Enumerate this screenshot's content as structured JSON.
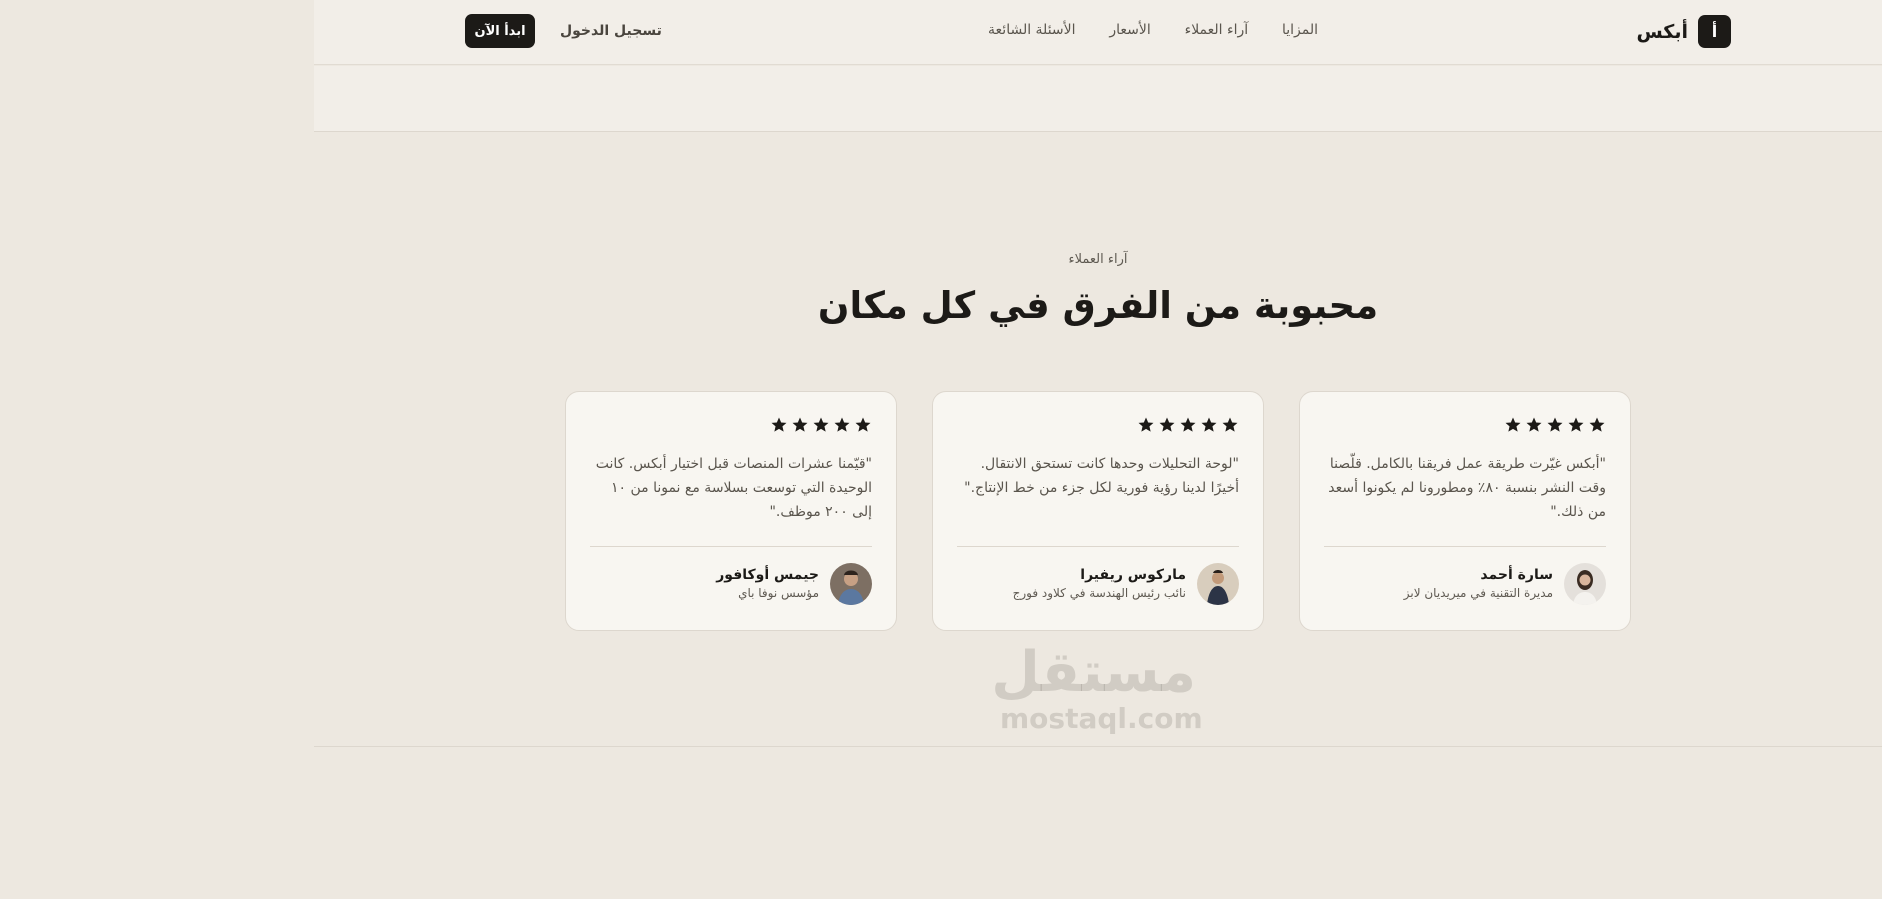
{
  "header": {
    "logo_letter": "أ",
    "brand_name": "أبكس",
    "nav": [
      "المزايا",
      "آراء العملاء",
      "الأسعار",
      "الأسئلة الشائعة"
    ],
    "login_label": "تسجيل الدخول",
    "cta_label": "ابدأ الآن"
  },
  "section": {
    "eyebrow": "آراء العملاء",
    "title": "محبوبة من الفرق في كل مكان"
  },
  "testimonials": [
    {
      "rating": 5,
      "quote": "\"أبكس غيّرت طريقة عمل فريقنا بالكامل. قلّصنا وقت النشر بنسبة ٨٠٪ ومطورونا لم يكونوا أسعد من ذلك.\"",
      "name": "سارة أحمد",
      "role": "مديرة التقنية في ميريديان لابز"
    },
    {
      "rating": 5,
      "quote": "\"لوحة التحليلات وحدها كانت تستحق الانتقال. أخيرًا لدينا رؤية فورية لكل جزء من خط الإنتاج.\"",
      "name": "ماركوس ريفيرا",
      "role": "نائب رئيس الهندسة في كلاود فورج"
    },
    {
      "rating": 5,
      "quote": "\"قيّمنا عشرات المنصات قبل اختيار أبكس. كانت الوحيدة التي توسعت بسلاسة مع نمونا من ١٠ إلى ٢٠٠ موظف.\"",
      "name": "جيمس أوكافور",
      "role": "مؤسس نوفا باي"
    }
  ],
  "watermark": {
    "arabic": "مستقل",
    "latin": "mostaql.com"
  },
  "colors": {
    "page_bg": "#ede8e0",
    "header_bg": "#f2eee8",
    "card_bg": "#f8f6f1",
    "dark": "#1c1a17"
  }
}
